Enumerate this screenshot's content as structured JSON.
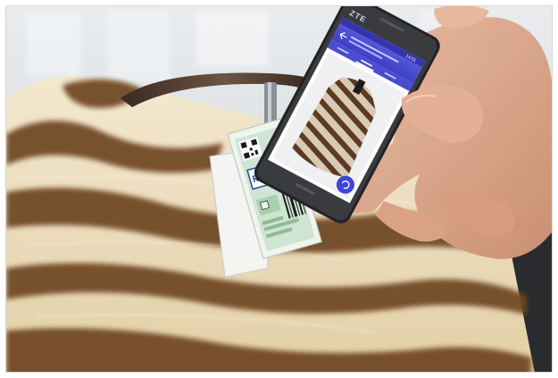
{
  "photo": {
    "subject": "fur-coat-with-rfid-tag-scanned-by-smartphone"
  },
  "tag": {
    "country_code": "RU"
  },
  "phone": {
    "brand": "ZTE",
    "status_time": "14:01"
  },
  "colors": {
    "fur_light": "#efe3c8",
    "fur_dark": "#6e4522",
    "phone_screen_blue": "#4f52d6",
    "fab_blue": "#3d46d8"
  },
  "icons": [
    "camera-fab-icon",
    "back-arrow-icon",
    "barcode-icon",
    "qr-code-icon"
  ]
}
